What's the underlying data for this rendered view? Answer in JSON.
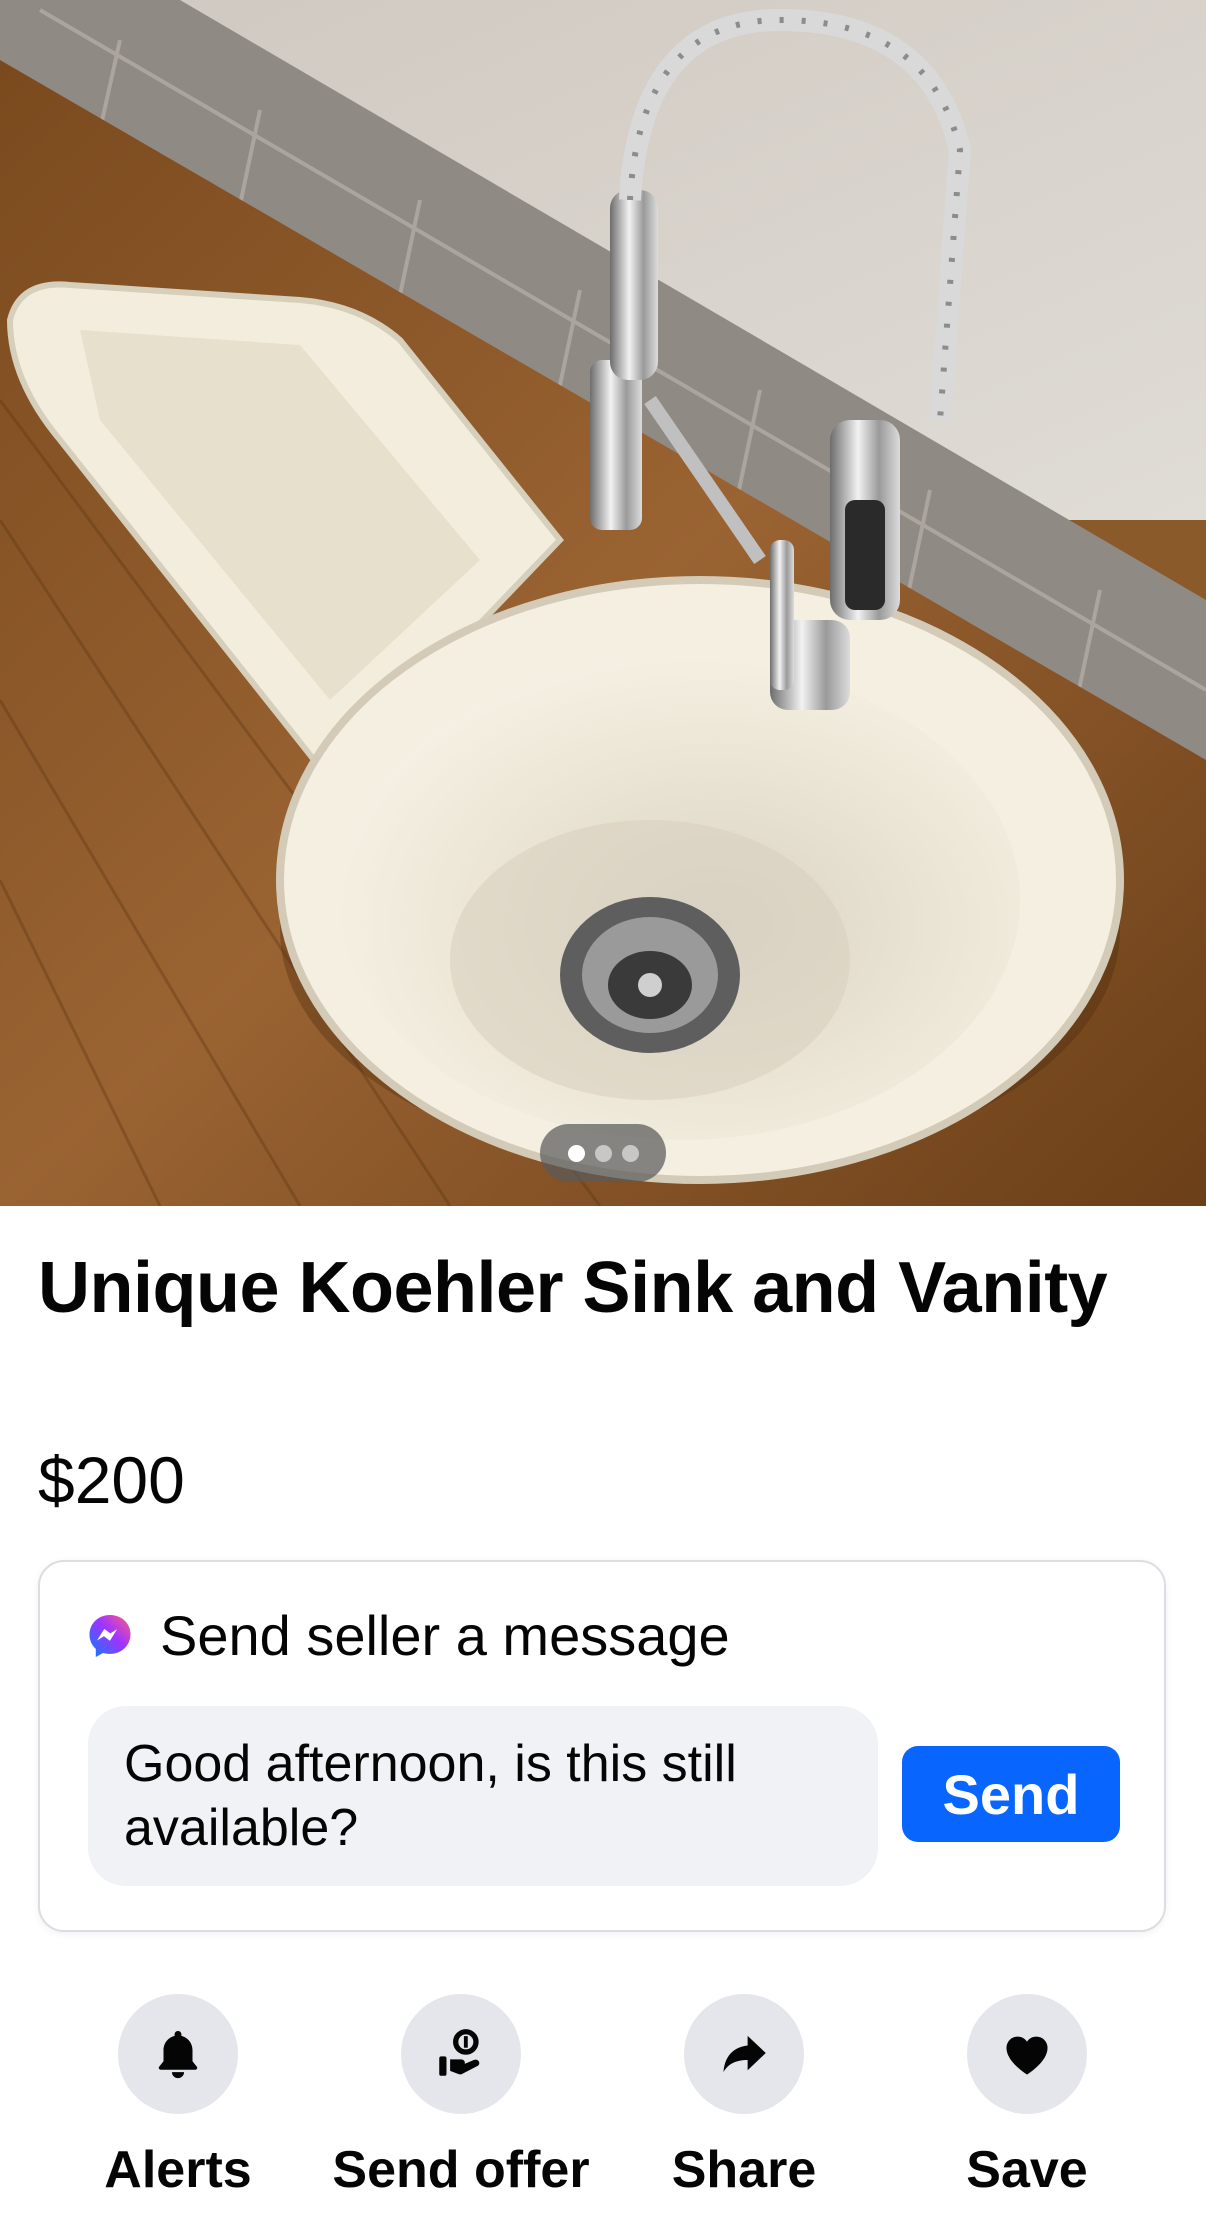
{
  "listing": {
    "title": "Unique Koehler Sink and Vanity",
    "price": "$200",
    "photo_count": 3,
    "active_photo_index": 0
  },
  "message_card": {
    "header": "Send seller a message",
    "icon": "messenger-icon",
    "input_value": "Good afternoon, is this still available?",
    "send_label": "Send",
    "accent": "#0866ff"
  },
  "actions": [
    {
      "label": "Alerts",
      "icon": "bell-icon"
    },
    {
      "label": "Send offer",
      "icon": "offer-icon"
    },
    {
      "label": "Share",
      "icon": "share-arrow-icon"
    },
    {
      "label": "Save",
      "icon": "heart-icon"
    }
  ]
}
